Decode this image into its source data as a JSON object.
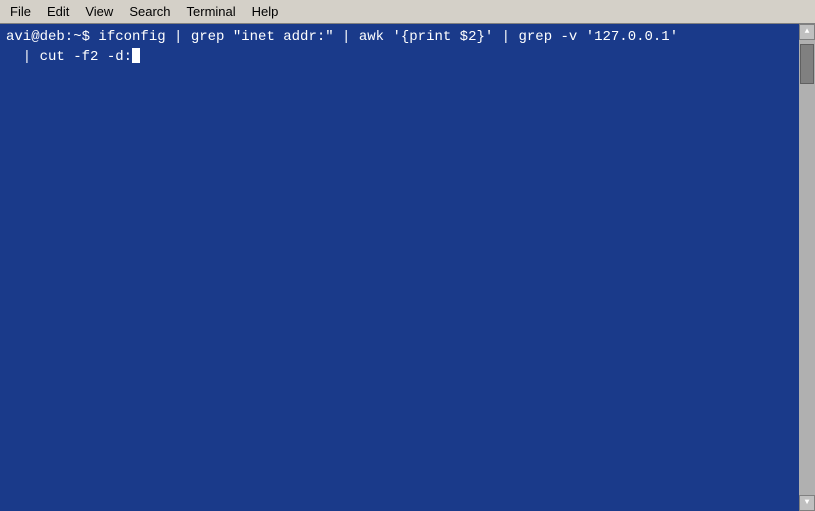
{
  "menubar": {
    "items": [
      {
        "label": "File",
        "id": "file"
      },
      {
        "label": "Edit",
        "id": "edit"
      },
      {
        "label": "View",
        "id": "view"
      },
      {
        "label": "Search",
        "id": "search"
      },
      {
        "label": "Terminal",
        "id": "terminal"
      },
      {
        "label": "Help",
        "id": "help"
      }
    ]
  },
  "terminal": {
    "prompt": "avi@deb:~$",
    "command_line1": " ifconfig | grep \"inet addr:\" | awk '{print $2}' | grep -v '127.0.0.1'",
    "command_line2": "  | cut -f2 -d:",
    "cursor_visible": true
  }
}
